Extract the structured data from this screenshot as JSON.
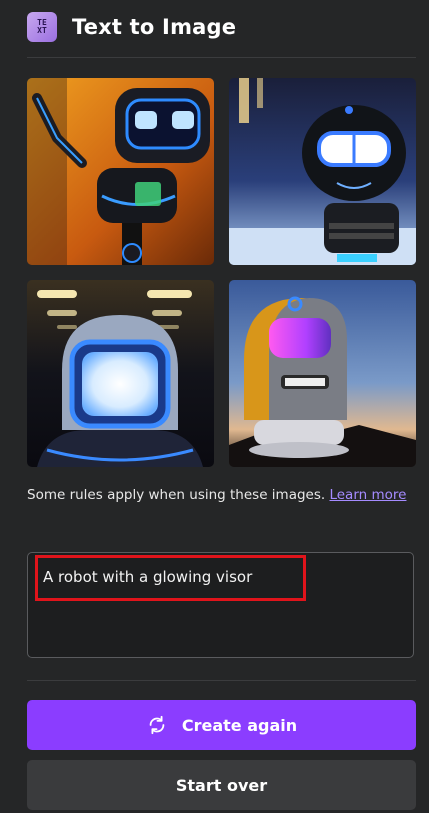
{
  "header": {
    "title": "Text to Image",
    "icon": "text-to-image-app-icon",
    "icon_letters": [
      "TE",
      "XT"
    ]
  },
  "gallery": {
    "images": [
      {
        "icon": "robot-image-1"
      },
      {
        "icon": "robot-image-2"
      },
      {
        "icon": "robot-image-3"
      },
      {
        "icon": "robot-image-4"
      }
    ]
  },
  "rules": {
    "text": "Some rules apply when using these images. ",
    "link_label": "Learn more"
  },
  "prompt": {
    "value": "A robot with a glowing visor"
  },
  "actions": {
    "create_again_label": "Create again",
    "create_again_icon": "refresh-icon",
    "start_over_label": "Start over"
  },
  "colors": {
    "background": "#252627",
    "accent": "#8b3dff",
    "highlight": "#e0141b",
    "link": "#a58bff"
  }
}
